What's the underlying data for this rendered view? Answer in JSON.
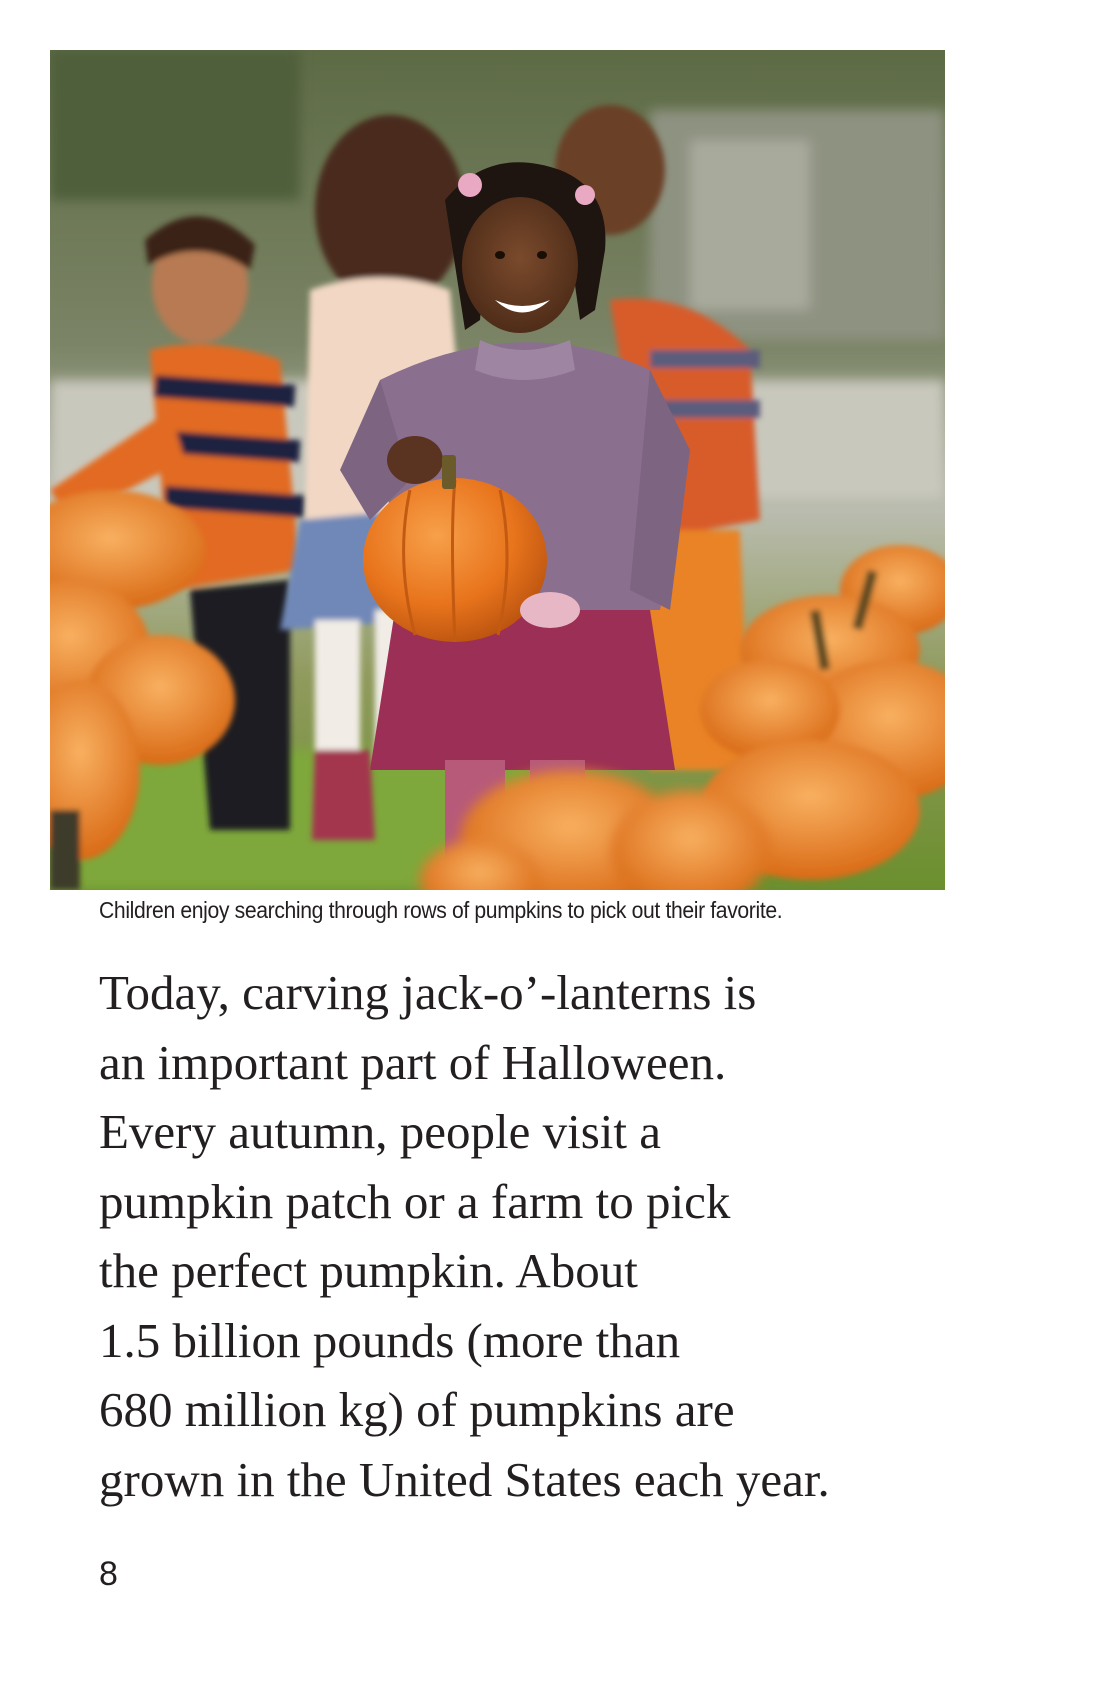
{
  "photo": {
    "subject": "girl-with-pumpkin-photo"
  },
  "caption": "Children enjoy searching through rows of pumpkins to pick out their favorite.",
  "body": {
    "lines": [
      "Today, carving jack-o’-lanterns is",
      "an important part of Halloween.",
      "Every autumn, people visit a",
      "pumpkin patch or a farm to pick",
      "the perfect pumpkin. About",
      "1.5 billion pounds (more than",
      "680 million kg) of pumpkins are",
      "grown in the United States each year."
    ]
  },
  "page_number": "8",
  "colors": {
    "text": "#231f20",
    "pumpkin": "#e8741c",
    "sweater": "#8a6f8e",
    "skirt": "#9b2f55"
  }
}
